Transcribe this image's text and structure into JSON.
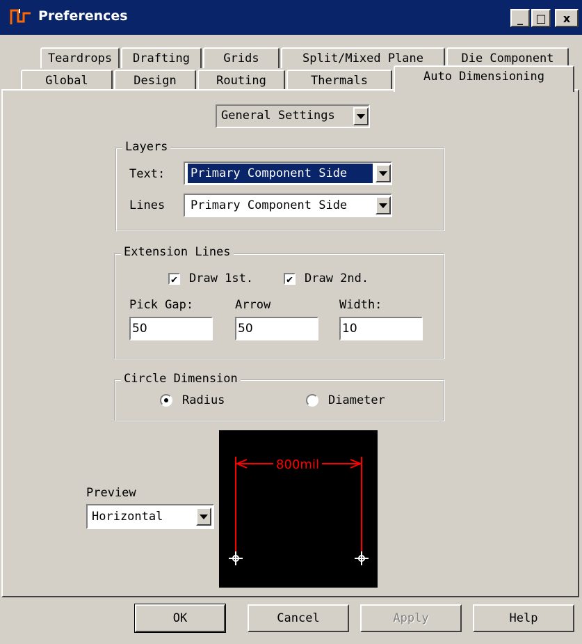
{
  "window": {
    "title": "Preferences",
    "min": "_",
    "max": "□",
    "close": "x"
  },
  "tabs_row1": [
    "Teardrops",
    "Drafting",
    "Grids",
    "Split/Mixed Plane",
    "Die Component"
  ],
  "tabs_row2": [
    "Global",
    "Design",
    "Routing",
    "Thermals",
    "Auto Dimensioning"
  ],
  "settings_select": {
    "value": "General Settings"
  },
  "layers": {
    "title": "Layers",
    "text_label": "Text:",
    "text_value": "Primary Component Side",
    "lines_label": "Lines",
    "lines_value": "Primary Component Side"
  },
  "extension_lines": {
    "title": "Extension Lines",
    "draw1_label": "Draw 1st.",
    "draw1_checked": true,
    "draw2_label": "Draw 2nd.",
    "draw2_checked": true,
    "pick_gap_label": "Pick Gap:",
    "pick_gap_value": "50",
    "arrow_label": "Arrow",
    "arrow_value": "50",
    "width_label": "Width:",
    "width_value": "10"
  },
  "circle_dimension": {
    "title": "Circle Dimension",
    "radius_label": "Radius",
    "diameter_label": "Diameter",
    "selected": "Radius"
  },
  "preview": {
    "label": "Preview",
    "value": "Horizontal",
    "dimension_text": "800mil",
    "colors": {
      "background": "#000000",
      "dimension": "#ff0000",
      "marker": "#ffffff"
    }
  },
  "buttons": {
    "ok": "OK",
    "cancel": "Cancel",
    "apply": "Apply",
    "help": "Help"
  }
}
